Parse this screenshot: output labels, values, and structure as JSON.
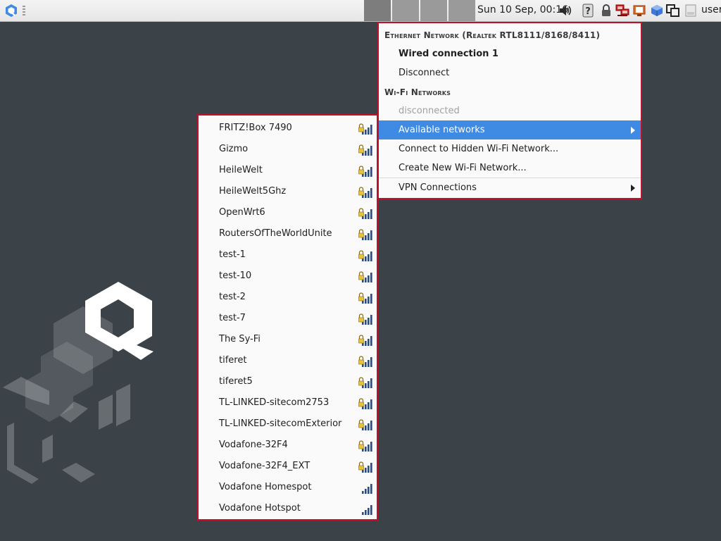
{
  "panel": {
    "clock": "Sun 10 Sep, 00:16",
    "user": "user",
    "icons": [
      "app-menu-icon",
      "desktop-1",
      "desktop-2",
      "desktop-3",
      "desktop-4",
      "volume-icon",
      "help-icon",
      "lock-icon",
      "network-icon",
      "monitor-icon",
      "package-icon",
      "windows-icon",
      "file-icon"
    ]
  },
  "main_menu": {
    "ethernet_header": "Ethernet Network (Realtek RTL8111/8168/8411)",
    "wired_connection": "Wired connection 1",
    "disconnect": "Disconnect",
    "wifi_header": "Wi-Fi Networks",
    "wifi_status": "disconnected",
    "available_networks": "Available networks",
    "connect_hidden": "Connect to Hidden Wi-Fi Network...",
    "create_new": "Create New Wi-Fi Network...",
    "vpn": "VPN Connections"
  },
  "networks": [
    {
      "ssid": "FRITZ!Box 7490",
      "secured": true
    },
    {
      "ssid": "Gizmo",
      "secured": true
    },
    {
      "ssid": "HeileWelt",
      "secured": true
    },
    {
      "ssid": "HeileWelt5Ghz",
      "secured": true
    },
    {
      "ssid": "OpenWrt6",
      "secured": true
    },
    {
      "ssid": "RoutersOfTheWorldUnite",
      "secured": true
    },
    {
      "ssid": "test-1",
      "secured": true
    },
    {
      "ssid": "test-10",
      "secured": true
    },
    {
      "ssid": "test-2",
      "secured": true
    },
    {
      "ssid": "test-7",
      "secured": true
    },
    {
      "ssid": "The Sy-Fi",
      "secured": true
    },
    {
      "ssid": "tiferet",
      "secured": true
    },
    {
      "ssid": "tiferet5",
      "secured": true
    },
    {
      "ssid": "TL-LINKED-sitecom2753",
      "secured": true
    },
    {
      "ssid": "TL-LINKED-sitecomExterior",
      "secured": true
    },
    {
      "ssid": "Vodafone-32F4",
      "secured": true
    },
    {
      "ssid": "Vodafone-32F4_EXT",
      "secured": true
    },
    {
      "ssid": "Vodafone Homespot",
      "secured": false
    },
    {
      "ssid": "Vodafone Hotspot",
      "secured": false
    }
  ],
  "colors": {
    "highlight": "#3f8ae2",
    "menu_border": "#c0102a",
    "desktop": "#3b4248"
  }
}
